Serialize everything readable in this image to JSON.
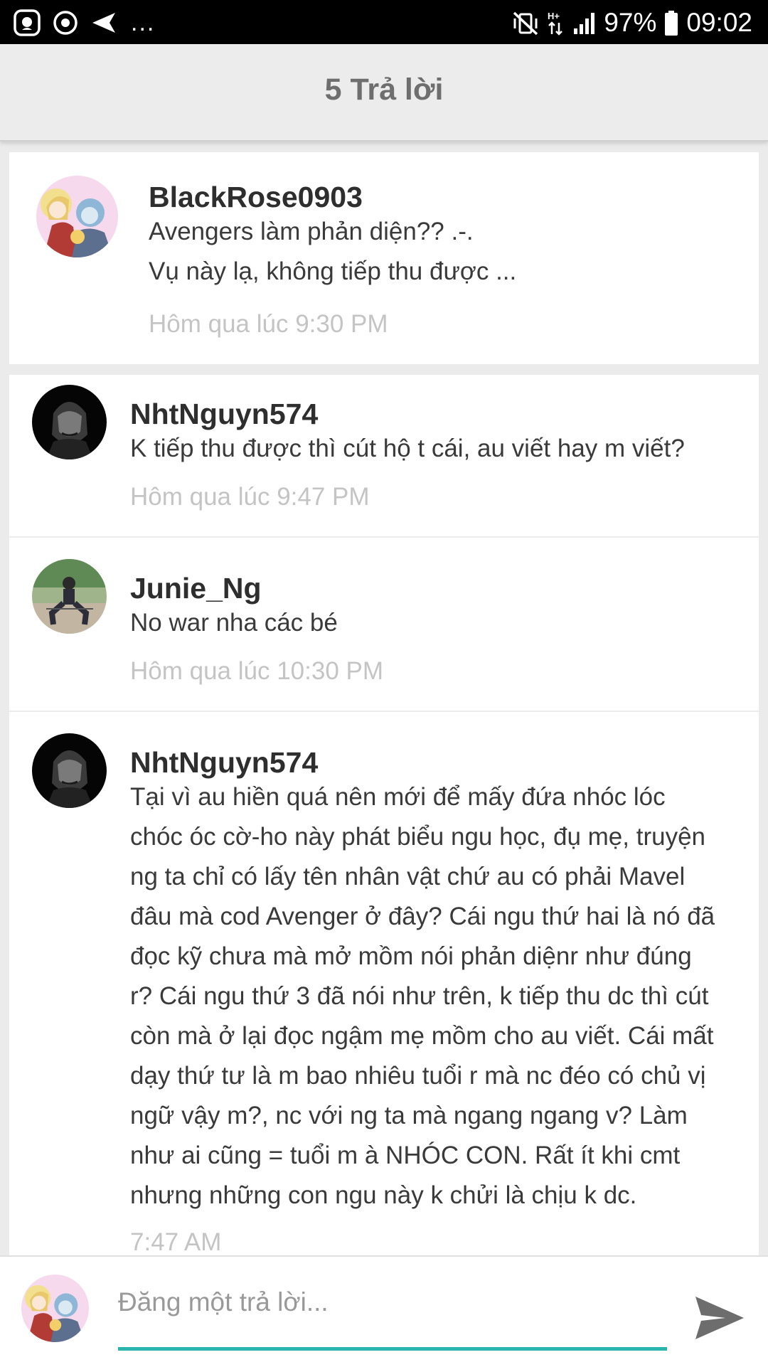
{
  "status_bar": {
    "battery": "97%",
    "time": "09:02",
    "more": "...",
    "network": "H+"
  },
  "header": {
    "title": "5 Trả lời"
  },
  "comments": [
    {
      "author": "BlackRose0903",
      "lines": [
        "Avengers làm phản diện?? .-.",
        "Vụ này lạ, không tiếp thu được ..."
      ],
      "time": "Hôm qua lúc 9:30 PM"
    },
    {
      "author": "NhtNguyn574",
      "lines": [
        "K tiếp thu được thì cút hộ t cái, au viết hay m viết?"
      ],
      "time": "Hôm qua lúc 9:47 PM"
    },
    {
      "author": "Junie_Ng",
      "lines": [
        "No war nha các bé"
      ],
      "time": "Hôm qua lúc 10:30 PM"
    },
    {
      "author": "NhtNguyn574",
      "lines": [
        "Tại vì au hiền quá nên mới để mấy đứa nhóc lóc",
        "chóc óc cờ-ho này phát biểu ngu học, đụ mẹ, truyện",
        "ng ta chỉ có lấy tên nhân vật chứ au có phải Mavel",
        "đâu mà cod Avenger ở đây? Cái ngu thứ hai là nó đã",
        "đọc kỹ chưa mà mở mồm nói phản diệnr như đúng",
        "r? Cái ngu thứ 3 đã nói như trên, k tiếp thu dc thì cút",
        "còn mà ở lại đọc ngậm mẹ mồm cho au viết. Cái mất",
        "dạy thứ tư là m bao nhiêu tuổi r mà nc đéo có chủ vị",
        "ngữ vậy m?, nc với ng ta mà ngang ngang v? Làm",
        "như ai cũng = tuổi m à NHÓC CON. Rất ít khi cmt",
        "nhưng những con ngu này k chửi là chịu k dc."
      ],
      "time": "7:47 AM"
    }
  ],
  "reply": {
    "placeholder": "Đăng một trả lời..."
  },
  "colors": {
    "accent": "#29b5ad",
    "header_bg": "#ececec",
    "page_bg": "#ebebeb",
    "timestamp": "#c4c4c4",
    "title": "#6e6e6e"
  },
  "icons": {
    "status_left": [
      "messenger-app-icon",
      "media-player-icon",
      "location-arrow-icon"
    ],
    "status_right": [
      "mute-vibrate-icon",
      "network-arrows-icon",
      "signal-icon",
      "battery-icon"
    ],
    "send": "send-arrow-icon"
  }
}
